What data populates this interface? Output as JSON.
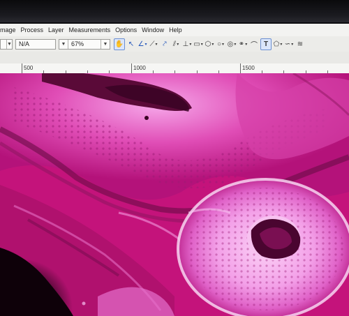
{
  "menubar": {
    "items": [
      "mage",
      "Process",
      "Layer",
      "Measurements",
      "Options",
      "Window",
      "Help"
    ]
  },
  "toolbar": {
    "first_select_value": "",
    "unit_select_value": "N/A",
    "zoom_select_value": "67%",
    "tools": [
      "hand-icon",
      "pointer-arrow-icon",
      "angle-icon",
      "line-icon",
      "polyline-icon",
      "parallel-lines-icon",
      "perpendicular-icon",
      "rectangle-icon",
      "polygon-icon",
      "circle-icon",
      "concentric-circles-icon",
      "link-icon",
      "arc-icon",
      "text-icon",
      "star-icon",
      "curve-icon",
      "more-icon"
    ]
  },
  "ruler": {
    "labels": [
      "500",
      "1000",
      "1500"
    ]
  },
  "colors": {
    "menubar_bg": "#f3f3f1",
    "toolbar_bg": "#ecece9",
    "tissue_magenta": "#c9157a",
    "tissue_light": "#f29ae6",
    "tissue_dark": "#5a0a38"
  }
}
